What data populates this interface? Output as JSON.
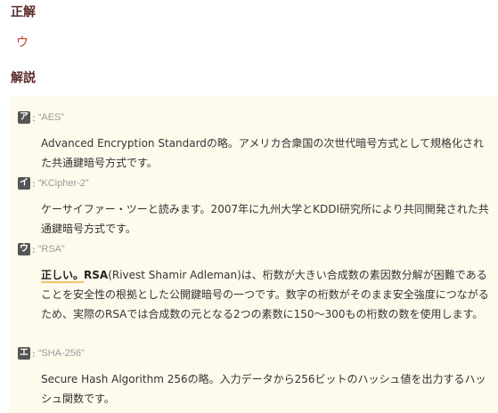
{
  "answer": {
    "heading": "正解",
    "value": "ウ"
  },
  "explanation": {
    "heading": "解説",
    "choices": [
      {
        "badge": "ア",
        "colon": ":",
        "term": "“AES”",
        "body": "Advanced Encryption Standardの略。アメリカ合衆国の次世代暗号方式として規格化された共通鍵暗号方式です。"
      },
      {
        "badge": "イ",
        "colon": ":",
        "term": "“KCipher-2”",
        "body": "ケーサイファー・ツーと読みます。2007年に九州大学とKDDI研究所により共同開発された共通鍵暗号方式です。"
      },
      {
        "badge": "ウ",
        "colon": ":",
        "term": "“RSA”",
        "correct_label": "正しい。",
        "bold_term": "RSA",
        "body": "(Rivest Shamir Adleman)は、桁数が大きい合成数の素因数分解が困難であることを安全性の根拠とした公開鍵暗号の一つです。数字の桁数がそのまま安全強度につながるため、実際のRSAでは合成数の元となる2つの素数に150～300もの桁数の数を使用します。"
      },
      {
        "badge": "エ",
        "colon": ":",
        "term": "“SHA-256”",
        "body": "Secure Hash Algorithm 256の略。入力データから256ビットのハッシュ値を出力するハッシュ関数です。"
      }
    ]
  },
  "colors": {
    "heading": "#5a2b2b",
    "answer": "#c0392b",
    "box_background": "#fefaec",
    "badge_background": "#555555",
    "underline": "#f5c36a"
  }
}
